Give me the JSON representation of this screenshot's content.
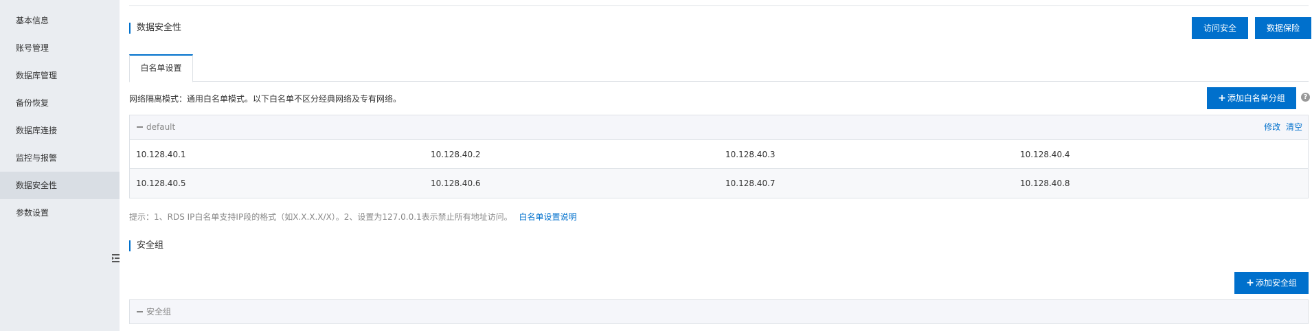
{
  "sidebar": {
    "items": [
      {
        "label": "基本信息"
      },
      {
        "label": "账号管理"
      },
      {
        "label": "数据库管理"
      },
      {
        "label": "备份恢复"
      },
      {
        "label": "数据库连接"
      },
      {
        "label": "监控与报警"
      },
      {
        "label": "数据安全性",
        "active": true
      },
      {
        "label": "参数设置"
      }
    ]
  },
  "header": {
    "title": "数据安全性",
    "access_security_label": "访问安全",
    "data_protection_label": "数据保险"
  },
  "tabs": [
    {
      "label": "白名单设置",
      "active": true
    }
  ],
  "whitelist": {
    "mode_text": "网络隔离模式：通用白名单模式。以下白名单不区分经典网络及专有网络。",
    "add_group_label": "添加白名单分组",
    "help_glyph": "?",
    "group": {
      "name": "default",
      "edit_label": "修改",
      "clear_label": "清空",
      "rows": [
        [
          "10.128.40.1",
          "10.128.40.2",
          "10.128.40.3",
          "10.128.40.4"
        ],
        [
          "10.128.40.5",
          "10.128.40.6",
          "10.128.40.7",
          "10.128.40.8"
        ]
      ]
    },
    "hint_text": "提示：1、RDS IP白名单支持IP段的格式（如X.X.X.X/X）。2、设置为127.0.0.1表示禁止所有地址访问。",
    "hint_link": "白名单设置说明"
  },
  "security_group": {
    "title": "安全组",
    "add_label": "添加安全组",
    "group_name": "安全组"
  },
  "colors": {
    "accent": "#0070cc",
    "sidebar_bg": "#eaedf1",
    "sidebar_active": "#d9dee4",
    "border": "#dde1e6"
  }
}
